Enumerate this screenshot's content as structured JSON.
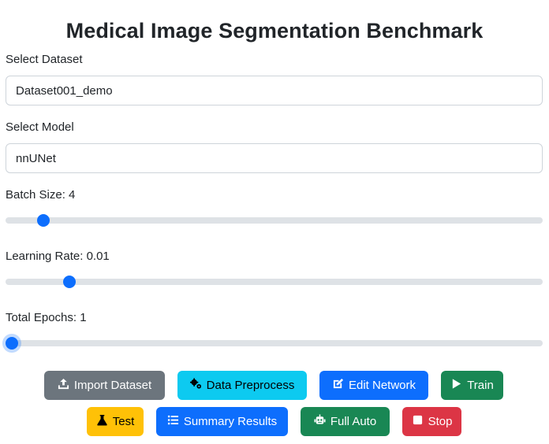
{
  "page": {
    "title": "Medical Image Segmentation Benchmark"
  },
  "dataset": {
    "label": "Select Dataset",
    "value": "Dataset001_demo"
  },
  "model": {
    "label": "Select Model",
    "value": "nnUNet"
  },
  "batch_size": {
    "label": "Batch Size: 4",
    "value": 4,
    "fraction": 0.06
  },
  "learning_rate": {
    "label": "Learning Rate: 0.01",
    "value": 0.01,
    "fraction": 0.11
  },
  "epochs": {
    "label": "Total Epochs: 1",
    "value": 1,
    "fraction": 0.0
  },
  "buttons": {
    "import": {
      "label": "Import Dataset",
      "icon": "upload-icon",
      "color": "#6c757d"
    },
    "preprocess": {
      "label": "Data Preprocess",
      "icon": "gears-icon",
      "color": "#0dcaf0"
    },
    "edit": {
      "label": "Edit Network",
      "icon": "edit-icon",
      "color": "#0d6efd"
    },
    "train": {
      "label": "Train",
      "icon": "play-icon",
      "color": "#198754"
    },
    "test": {
      "label": "Test",
      "icon": "flask-icon",
      "color": "#ffc107"
    },
    "summary": {
      "label": "Summary Results",
      "icon": "list-icon",
      "color": "#0d6efd"
    },
    "auto": {
      "label": "Full Auto",
      "icon": "robot-icon",
      "color": "#198754"
    },
    "stop": {
      "label": "Stop",
      "icon": "stop-icon",
      "color": "#dc3545"
    }
  }
}
